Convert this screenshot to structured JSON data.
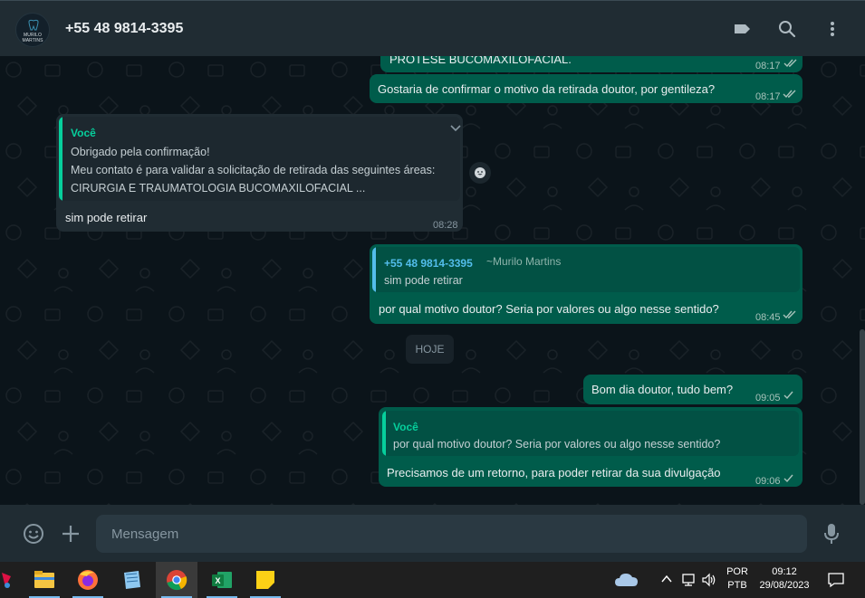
{
  "header": {
    "contact_name": "+55 48 9814-3395",
    "avatar_text": "MURILO MARTINS",
    "icons": [
      "label-icon",
      "search-icon",
      "more-vertical-icon"
    ]
  },
  "messages": {
    "m1": {
      "text": "PRÓTESE BUCOMAXILOFACIAL.",
      "time": "08:17"
    },
    "m2": {
      "text": "Gostaria de confirmar o motivo da retirada doutor, por gentileza?",
      "time": "08:17"
    },
    "m3": {
      "quote_name": "Você",
      "quote_lines": [
        "Obrigado pela confirmação!",
        "Meu contato é para validar a solicitação de retirada das seguintes áreas:",
        "CIRURGIA E TRAUMATOLOGIA BUCOMAXILOFACIAL ..."
      ],
      "text": "sim pode retirar",
      "time": "08:28"
    },
    "m4": {
      "quote_name": "+55 48 9814-3395",
      "quote_alias": "~Murilo Martins",
      "quote_text": "sim pode retirar",
      "text": "por qual motivo doutor? Seria por valores ou algo nesse sentido?",
      "time": "08:45"
    },
    "date_divider": "HOJE",
    "m5": {
      "text": "Bom dia doutor, tudo bem?",
      "time": "09:05"
    },
    "m6": {
      "quote_name": "Você",
      "quote_text": "por qual motivo doutor? Seria por valores ou algo nesse sentido?",
      "text": "Precisamos de um retorno, para poder retirar da sua divulgação",
      "time": "09:06"
    }
  },
  "composer": {
    "placeholder": "Mensagem"
  },
  "taskbar": {
    "apps": [
      "app-icon",
      "file-explorer-icon",
      "firefox-icon",
      "notepad-icon",
      "chrome-icon",
      "excel-icon",
      "sticky-notes-icon"
    ],
    "language_line1": "POR",
    "language_line2": "PTB",
    "clock_time": "09:12",
    "clock_date": "29/08/2023"
  },
  "colors": {
    "outgoing_bubble": "#005c4b",
    "incoming_bubble": "#202c33",
    "accent_green": "#25d366",
    "contact_blue": "#53bdeb"
  }
}
